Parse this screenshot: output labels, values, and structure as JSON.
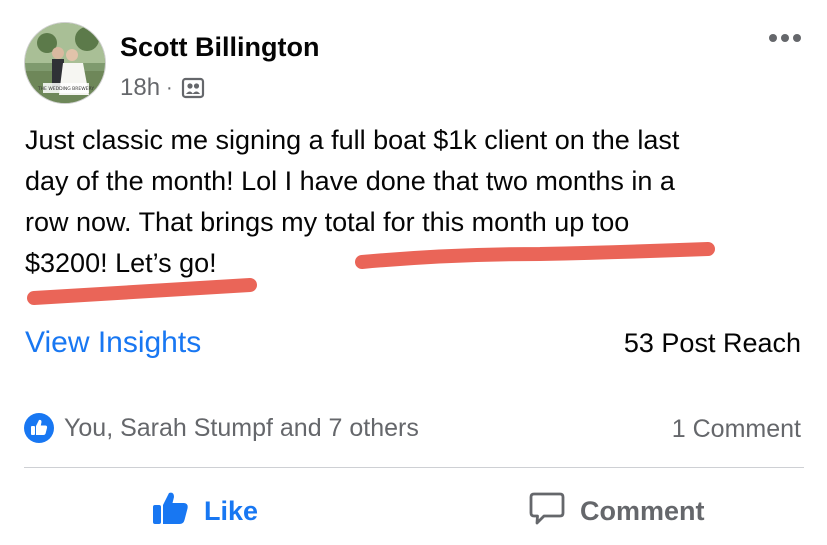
{
  "post": {
    "author_name": "Scott Billington",
    "timestamp": "18h",
    "separator": "·",
    "audience_icon": "friends-audience-icon",
    "avatar_watermark": "THE WEDDING BREWERY",
    "more_icon": "more-options-icon",
    "text_lines": [
      "Just classic me signing a full boat $1k client on the last",
      "day of the month! Lol I have done that two months in a",
      "row now. That brings my total for this month up too",
      "$3200! Let’s go!"
    ],
    "highlight_color": "#e8584a"
  },
  "insights": {
    "link_label": "View Insights",
    "reach_label": "53 Post Reach"
  },
  "reactions": {
    "icon": "like-reaction-icon",
    "summary": "You, Sarah Stumpf and 7 others",
    "comments_count": "1 Comment"
  },
  "actions": {
    "like_label": "Like",
    "like_icon": "thumbs-up-icon",
    "comment_label": "Comment",
    "comment_icon": "speech-bubble-icon"
  },
  "colors": {
    "accent": "#1877f2",
    "secondary_text": "#65676b",
    "primary_text": "#050505",
    "divider": "#ced0d4"
  }
}
